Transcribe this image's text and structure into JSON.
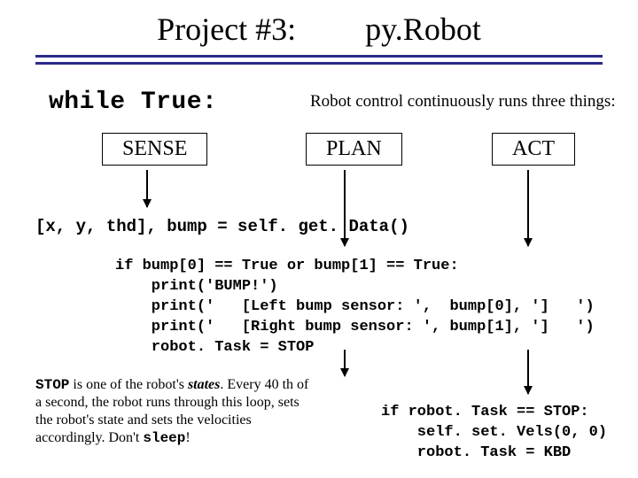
{
  "title": {
    "left": "Project #3:",
    "right": "py.Robot"
  },
  "while_label": "while True:",
  "subtitle_note": "Robot control continuously runs three things:",
  "spa": {
    "sense": "SENSE",
    "plan": "PLAN",
    "act": "ACT"
  },
  "getdata_line": "[x, y, thd], bump = self. get. Data()",
  "code_block": "if bump[0] == True or bump[1] == True:\n    print('BUMP!')\n    print('   [Left bump sensor: ',  bump[0], ']   ')\n    print('   [Right bump sensor: ', bump[1], ']   ')\n    robot. Task = STOP",
  "stop_note": {
    "stop_word": "STOP",
    "part1": " is one of the robot's ",
    "states_word": "states",
    "part2": ". Every 40 th of a second, the robot runs through this loop, sets the robot's state and sets the velocities accordingly. Don't ",
    "sleep_word": "sleep",
    "excl": "!"
  },
  "act_code": "if robot. Task == STOP:\n    self. set. Vels(0, 0)\n    robot. Task = KBD"
}
